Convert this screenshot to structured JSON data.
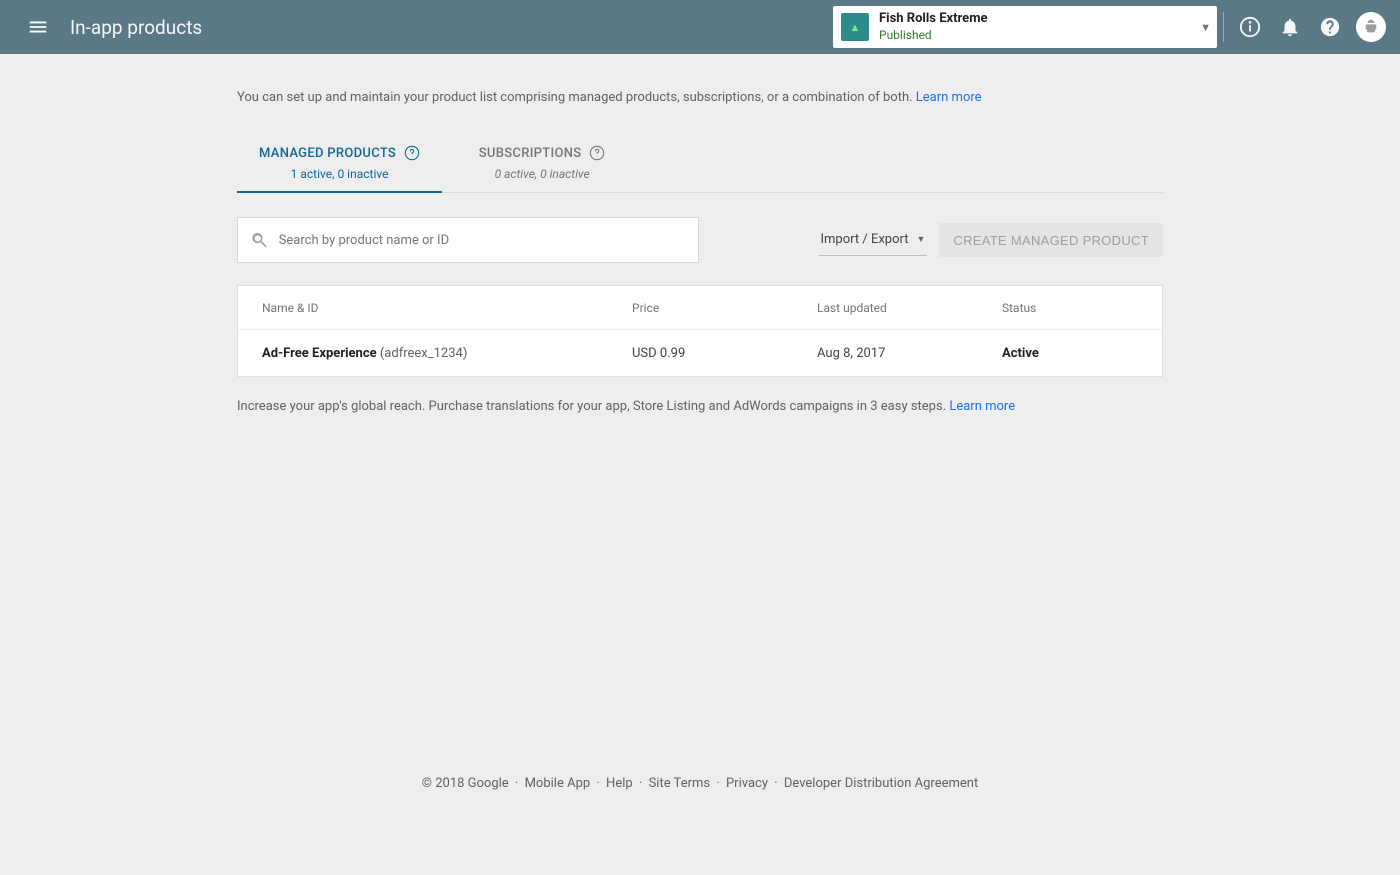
{
  "header": {
    "title": "In-app products",
    "app_name": "Fish Rolls Extreme",
    "app_status": "Published"
  },
  "intro": {
    "text": "You can set up and maintain your product list comprising managed products, subscriptions, or a combination of both. ",
    "learn_more": "Learn more"
  },
  "tabs": {
    "managed": {
      "label": "MANAGED PRODUCTS",
      "sub": "1 active, 0 inactive"
    },
    "subscriptions": {
      "label": "SUBSCRIPTIONS",
      "sub": "0 active, 0 inactive"
    }
  },
  "toolbar": {
    "search_placeholder": "Search by product name or ID",
    "import_export": "Import / Export",
    "create_button": "CREATE MANAGED PRODUCT"
  },
  "table": {
    "headers": {
      "name": "Name & ID",
      "price": "Price",
      "updated": "Last updated",
      "status": "Status"
    },
    "rows": [
      {
        "name": "Ad-Free Experience",
        "id": "(adfreex_1234)",
        "price": "USD 0.99",
        "updated": "Aug 8, 2017",
        "status": "Active"
      }
    ]
  },
  "translations": {
    "text": "Increase your app's global reach. Purchase translations for your app, Store Listing and AdWords campaigns in 3 easy steps. ",
    "learn_more": "Learn more"
  },
  "footer": {
    "copyright": "© 2018 Google",
    "links": [
      "Mobile App",
      "Help",
      "Site Terms",
      "Privacy",
      "Developer Distribution Agreement"
    ]
  }
}
